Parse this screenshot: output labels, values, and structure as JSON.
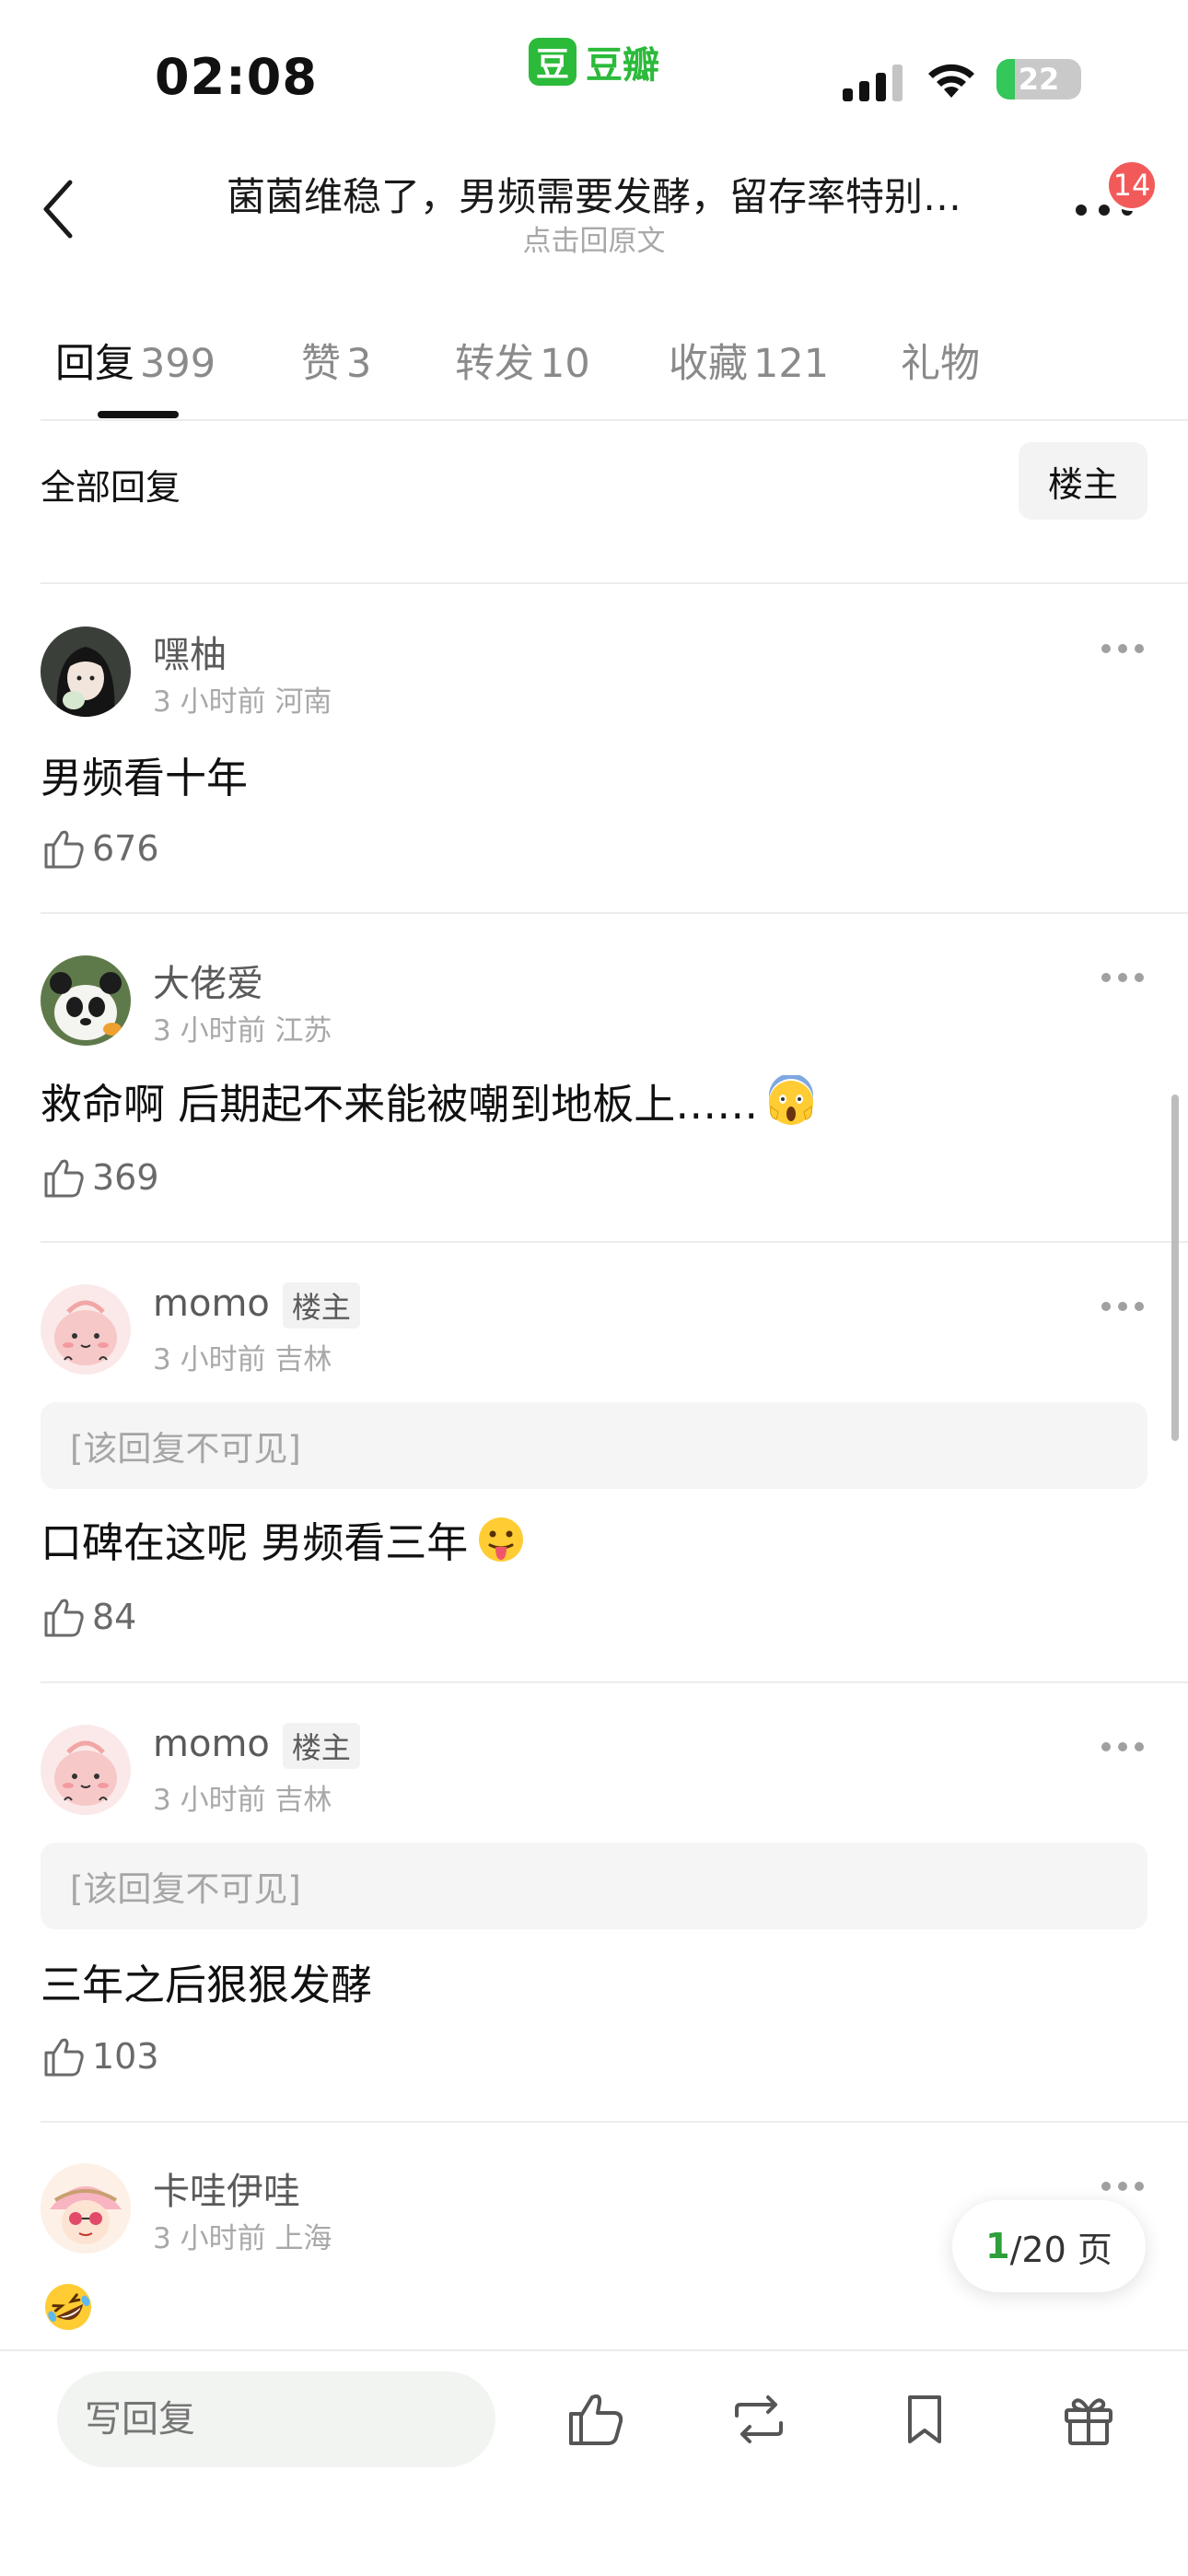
{
  "status_bar": {
    "time": "02:08",
    "app_icon_glyph": "豆",
    "app_name": "豆瓣",
    "battery": "22",
    "battery_level": 0.22,
    "battery_color": "#34c759"
  },
  "header": {
    "title": "菌菌维稳了，男频需要发酵，留存率特别…",
    "subtitle": "点击回原文",
    "notification_count": "14"
  },
  "tabs": [
    {
      "label": "回复",
      "count": "399"
    },
    {
      "label": "赞",
      "count": "3"
    },
    {
      "label": "转发",
      "count": "10"
    },
    {
      "label": "收藏",
      "count": "121"
    },
    {
      "label": "礼物",
      "count": ""
    }
  ],
  "filter": {
    "label": "全部回复",
    "op_button": "楼主"
  },
  "comments": [
    {
      "user": "嘿柚",
      "time": "3 小时前",
      "location": "河南",
      "text": "男频看十年",
      "likes": "676",
      "is_op": false,
      "emoji": ""
    },
    {
      "user": "大佬爱",
      "time": "3 小时前",
      "location": "江苏",
      "text": "救命啊  后期起不来能被嘲到地板上……",
      "likes": "369",
      "is_op": false,
      "emoji": "scream-emoji"
    },
    {
      "user": "momo",
      "op_tag": "楼主",
      "time": "3 小时前",
      "location": "吉林",
      "quote": "[该回复不可见]",
      "text": "口碑在这呢 男频看三年",
      "likes": "84",
      "is_op": true,
      "emoji": "tongue-emoji"
    },
    {
      "user": "momo",
      "op_tag": "楼主",
      "time": "3 小时前",
      "location": "吉林",
      "quote": "[该回复不可见]",
      "text": "三年之后狠狠发酵",
      "likes": "103",
      "is_op": true,
      "emoji": ""
    },
    {
      "user": "卡哇伊哇",
      "time": "3 小时前",
      "location": "上海",
      "text": "",
      "likes": "",
      "is_op": false,
      "emoji": "rofl-emoji"
    }
  ],
  "pagination": {
    "current": "1",
    "total": "/20 页"
  },
  "bottom_bar": {
    "reply_placeholder": "写回复",
    "icons": [
      "like-icon",
      "repost-icon",
      "bookmark-icon",
      "gift-icon"
    ]
  },
  "colors": {
    "accent_green": "#2cba3a",
    "badge_red": "#f25a5a"
  }
}
